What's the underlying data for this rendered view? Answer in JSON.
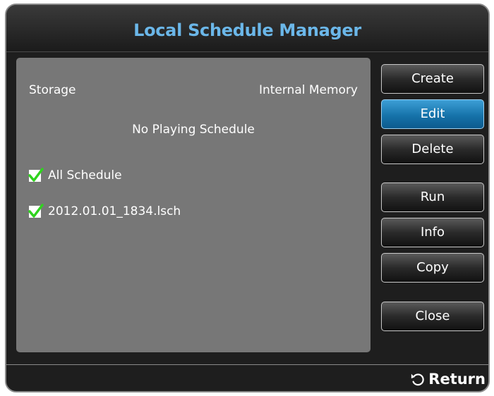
{
  "window": {
    "title": "Local Schedule Manager"
  },
  "panel": {
    "storage_label": "Storage",
    "storage_value": "Internal Memory",
    "status": "No Playing Schedule",
    "items": [
      {
        "label": "All Schedule",
        "checked": true
      },
      {
        "label": "2012.01.01_1834.lsch",
        "checked": true
      }
    ]
  },
  "buttons": {
    "create": "Create",
    "edit": "Edit",
    "delete": "Delete",
    "run": "Run",
    "info": "Info",
    "copy": "Copy",
    "close": "Close"
  },
  "footer": {
    "return_label": "Return",
    "return_icon": "return-arrow-icon"
  },
  "colors": {
    "title": "#6bb7e9",
    "active_button": "#1673aa",
    "check": "#2fd31e"
  }
}
